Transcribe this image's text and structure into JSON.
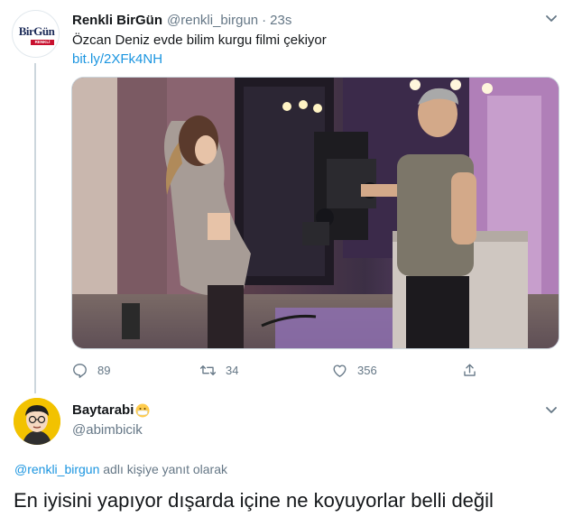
{
  "tweet": {
    "author_name": "Renkli BirGün",
    "author_handle": "@renkli_birgun",
    "separator": "·",
    "time": "23s",
    "text": "Özcan Deniz evde bilim kurgu filmi çekiyor",
    "link": "bit.ly/2XFk4NH",
    "avatar_logo_main": "BirGün",
    "avatar_logo_bar": "RENKLİ",
    "replies_count": "89",
    "retweets_count": "34",
    "likes_count": "356",
    "icons": {
      "reply": "reply-icon",
      "retweet": "retweet-icon",
      "like": "heart-icon",
      "share": "share-icon",
      "more": "chevron-down-icon"
    }
  },
  "reply": {
    "author_name": "Baytarabi",
    "author_handle": "@abimbicik",
    "replying_mention": "@renkli_birgun",
    "replying_suffix": " adlı kişiye yanıt olarak",
    "text": "En iyisini yapıyor dışarda içine ne koyuyorlar belli değil"
  },
  "colors": {
    "link": "#1b95e0",
    "muted": "#657786",
    "text": "#14171a"
  }
}
